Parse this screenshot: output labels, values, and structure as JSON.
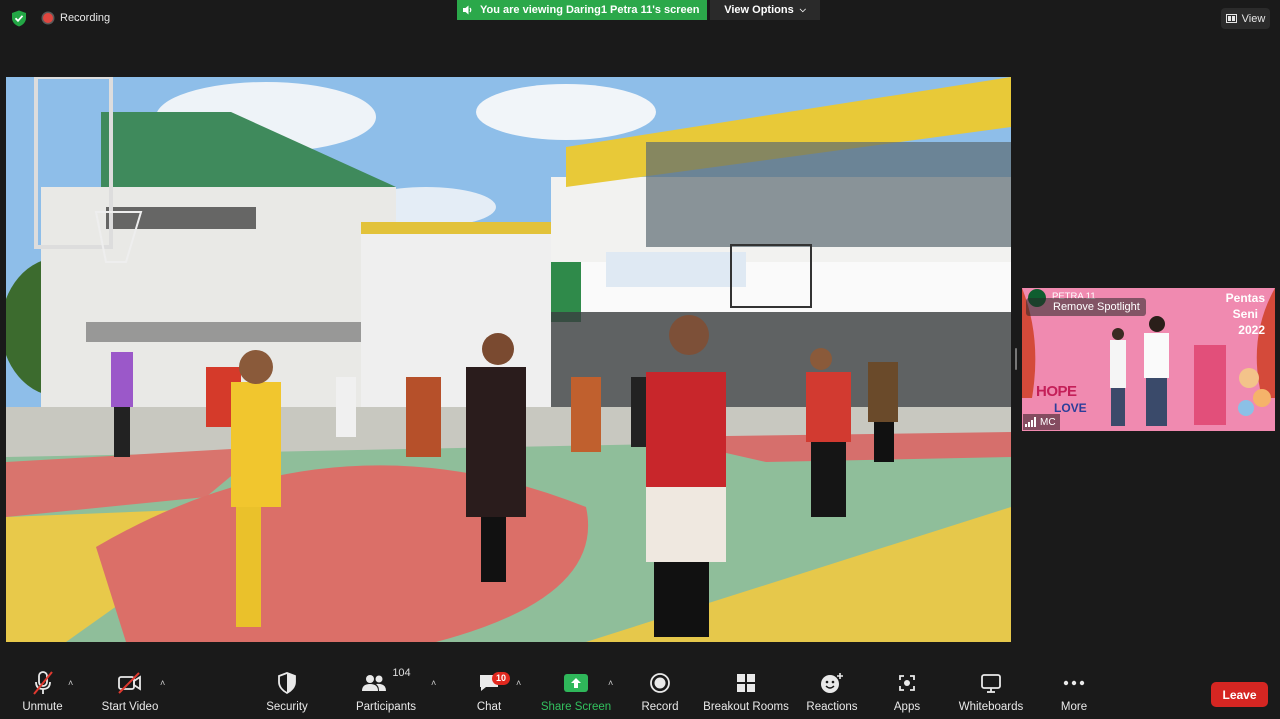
{
  "top": {
    "recording_label": "Recording",
    "banner_text": "You are viewing Daring1 Petra 11's screen",
    "view_options_label": "View Options",
    "view_label": "View"
  },
  "thumbnail": {
    "logo_text": "PETRA 11",
    "remove_spotlight_label": "Remove Spotlight",
    "participant_name": "MC",
    "poster_title_line1": "Pentas",
    "poster_title_line2": "Seni",
    "poster_year": "2022",
    "poster_word1": "HOPE",
    "poster_word2": "LOVE"
  },
  "toolbar": {
    "unmute_label": "Unmute",
    "start_video_label": "Start Video",
    "security_label": "Security",
    "participants_label": "Participants",
    "participants_count": "104",
    "chat_label": "Chat",
    "chat_badge": "10",
    "share_screen_label": "Share Screen",
    "record_label": "Record",
    "breakout_label": "Breakout Rooms",
    "reactions_label": "Reactions",
    "apps_label": "Apps",
    "whiteboards_label": "Whiteboards",
    "more_label": "More",
    "leave_label": "Leave"
  },
  "colors": {
    "share_green": "#2ba84a",
    "leave_red": "#d52622",
    "badge_red": "#e0281e",
    "background": "#1a1a1a"
  }
}
